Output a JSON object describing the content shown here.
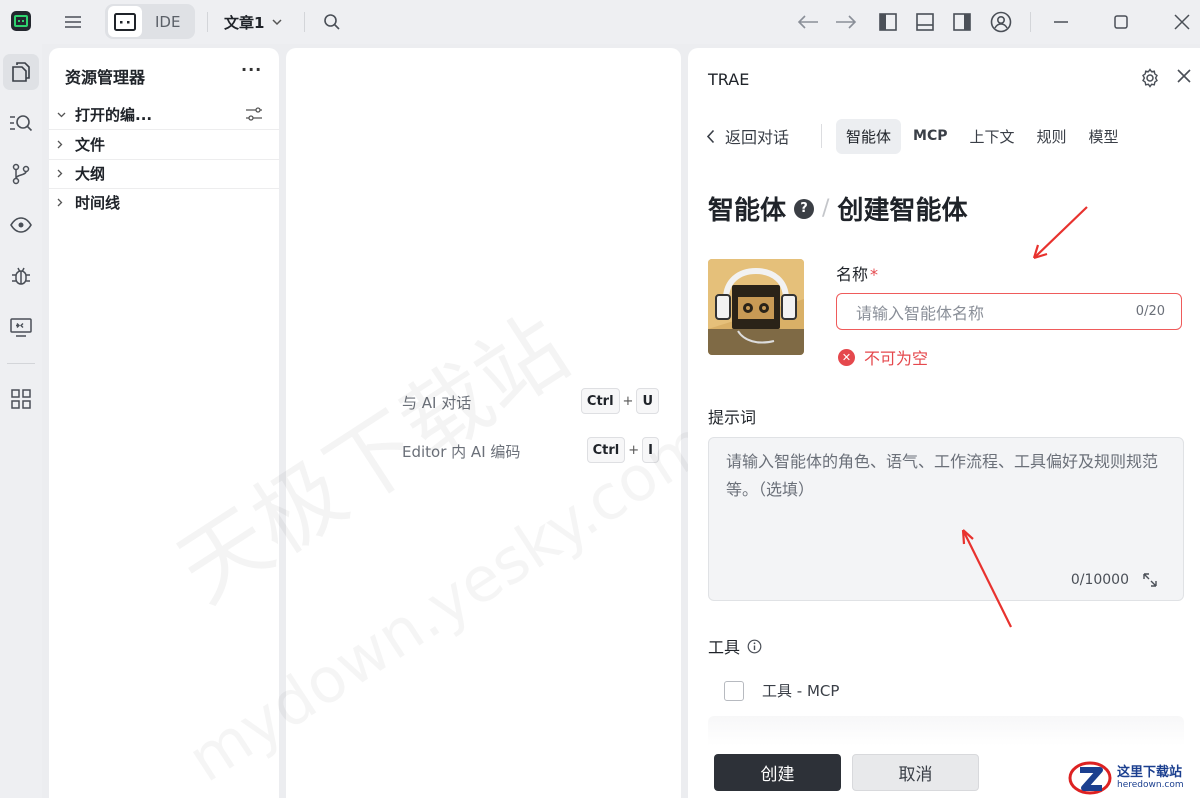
{
  "titlebar": {
    "mode_label": "IDE",
    "project_name": "文章1"
  },
  "explorer": {
    "title": "资源管理器",
    "more": "···",
    "sections": [
      {
        "label": "打开的编...",
        "expanded": true
      },
      {
        "label": "文件",
        "expanded": false
      },
      {
        "label": "大纲",
        "expanded": false
      },
      {
        "label": "时间线",
        "expanded": false
      }
    ]
  },
  "editor": {
    "hints": [
      {
        "text": "与 AI 对话",
        "keys": [
          "Ctrl",
          "U"
        ]
      },
      {
        "text": "Editor 内 AI 编码",
        "keys": [
          "Ctrl",
          "I"
        ]
      }
    ],
    "plus": "+",
    "watermark_cn": "天极下载站",
    "watermark_en": "mydown.yesky.com"
  },
  "panel": {
    "title": "TRAE",
    "back_label": "返回对话",
    "tabs": [
      "智能体",
      "MCP",
      "上下文",
      "规则",
      "模型"
    ],
    "active_tab": "智能体",
    "breadcrumb_root": "智能体",
    "breadcrumb_help": "?",
    "breadcrumb_sep": "/",
    "breadcrumb_current": "创建智能体",
    "name_label": "名称",
    "required_mark": "*",
    "name_placeholder": "请输入智能体名称",
    "name_count": "0/20",
    "name_error": "不可为空",
    "prompt_label": "提示词",
    "prompt_placeholder": "请输入智能体的角色、语气、工作流程、工具偏好及规则规范等。（选填）",
    "prompt_count": "0/10000",
    "tools_label": "工具",
    "tool_item": "工具 - MCP",
    "create_button": "创建",
    "cancel_button": "取消"
  },
  "corner_logo": {
    "title": "这里下载站",
    "subtitle": "heredown.com"
  },
  "colors": {
    "error": "#e5484d",
    "primary_button": "#2d3138",
    "annotation_arrow": "#e8322e"
  }
}
